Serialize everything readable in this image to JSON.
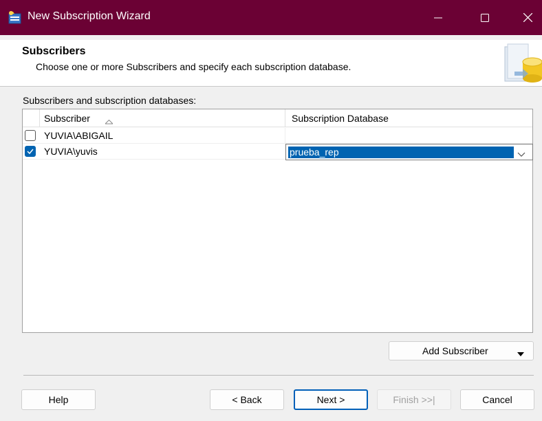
{
  "window": {
    "title": "New Subscription Wizard"
  },
  "header": {
    "title": "Subscribers",
    "subtitle": "Choose one or more Subscribers and specify each subscription database."
  },
  "list": {
    "label": "Subscribers and subscription databases:",
    "columns": [
      "Subscriber",
      "Subscription Database"
    ],
    "rows": [
      {
        "checked": false,
        "subscriber": "YUVIA\\ABIGAIL",
        "database": ""
      },
      {
        "checked": true,
        "subscriber": "YUVIA\\yuvis",
        "database": "prueba_rep"
      }
    ]
  },
  "buttons": {
    "add_subscriber": "Add Subscriber",
    "help": "Help",
    "back": "< Back",
    "next": "Next >",
    "finish": "Finish >>|",
    "cancel": "Cancel"
  },
  "colors": {
    "titlebar": "#6b0134",
    "selection": "#0063b1",
    "default_button_border": "#005fb8"
  },
  "icons": {
    "app": "wizard-app-icon",
    "header": "database-graphic-icon",
    "sort": "sort-ascending-icon",
    "dropdown": "chevron-down-icon"
  }
}
